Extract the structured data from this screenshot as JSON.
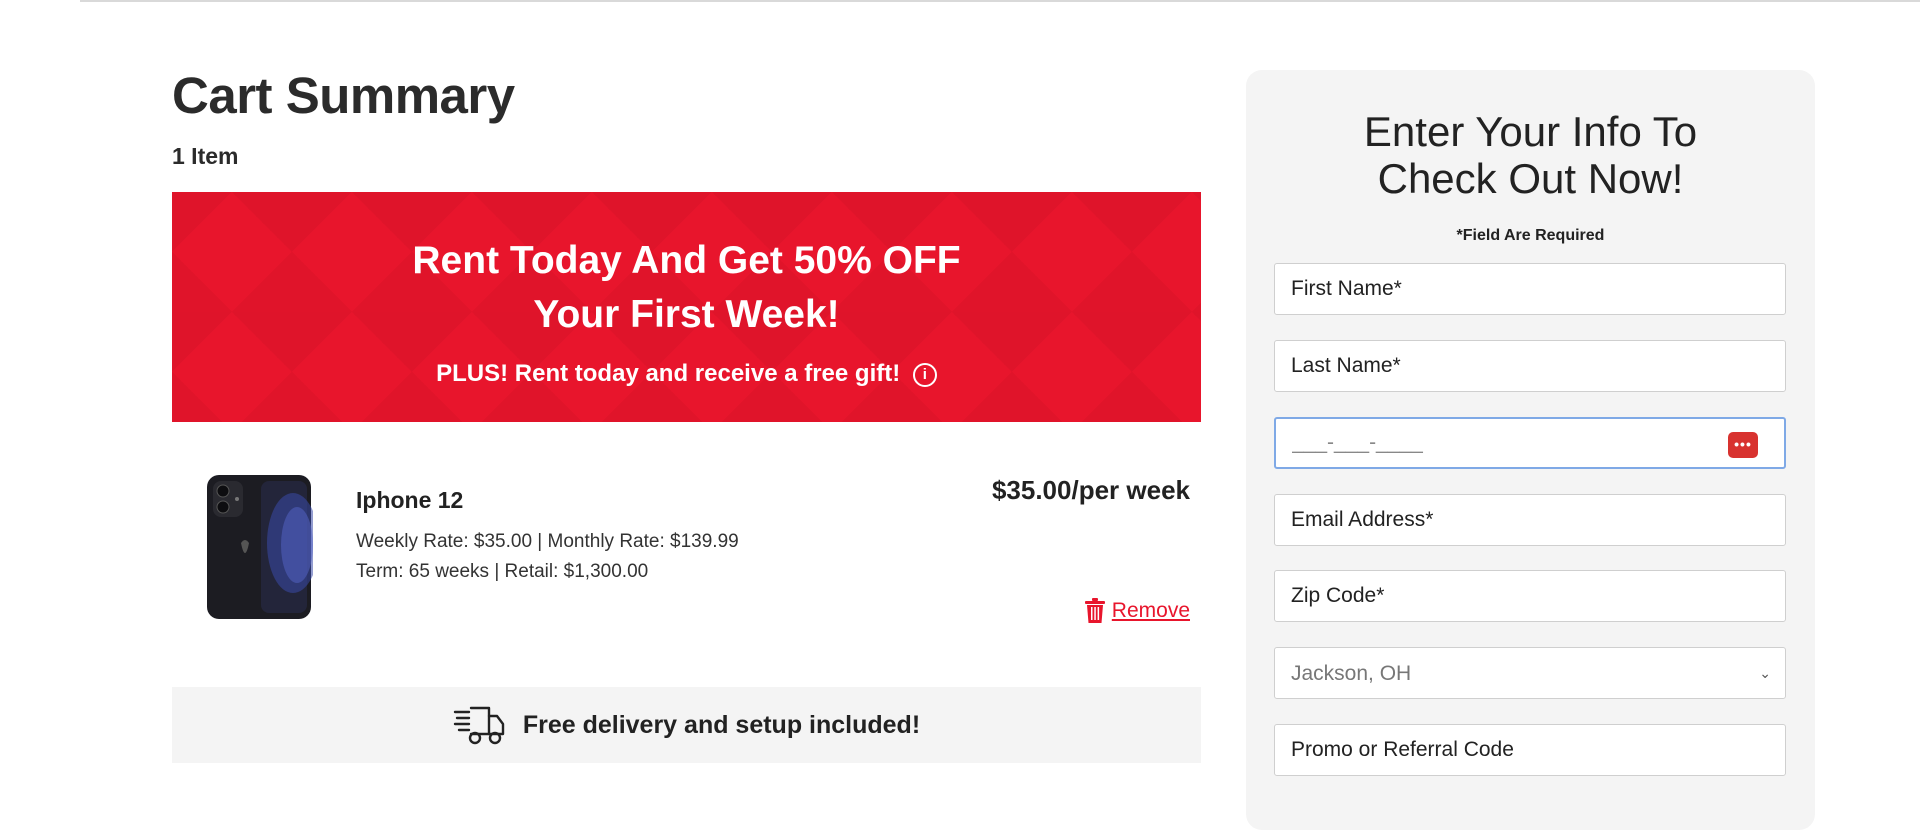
{
  "cart": {
    "title": "Cart Summary",
    "item_count": "1 Item"
  },
  "promo": {
    "headline_line1": "Rent Today And Get 50% OFF",
    "headline_line2": "Your First Week!",
    "subline": "PLUS! Rent today and receive a free gift!",
    "info_icon": "i"
  },
  "product": {
    "name": "Iphone 12",
    "rates": "Weekly Rate: $35.00 | Monthly Rate: $139.99",
    "term": "Term: 65 weeks | Retail: $1,300.00",
    "price": "$35.00/per week",
    "remove_label": "Remove",
    "image_icon": "iphone-image"
  },
  "delivery": {
    "icon": "delivery-truck-icon",
    "text": "Free delivery and setup included!"
  },
  "form": {
    "title_line1": "Enter Your Info To",
    "title_line2": "Check Out Now!",
    "required_note": "*Field Are Required",
    "first_name_placeholder": "First Name*",
    "last_name_placeholder": "Last Name*",
    "phone_placeholder": "___-___-____",
    "phone_autofill_icon": "•••",
    "email_placeholder": "Email Address*",
    "zip_placeholder": "Zip Code*",
    "location_selected": "Jackson, OH",
    "promo_placeholder": "Promo or Referral Code"
  },
  "colors": {
    "brand_red": "#e8152c",
    "panel_bg": "#f4f4f4",
    "focus_border": "#7fa9e6"
  }
}
